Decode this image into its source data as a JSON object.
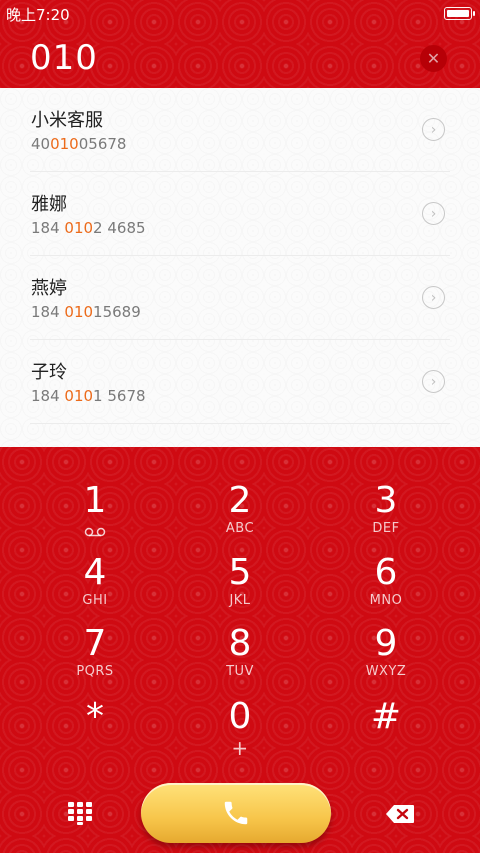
{
  "status_bar": {
    "time": "晚上7:20"
  },
  "query": "010",
  "contacts": [
    {
      "name": "小米客服",
      "num_pre": "40",
      "num_hl": "010",
      "num_post": "05678"
    },
    {
      "name": "雅娜",
      "num_pre": "184 ",
      "num_hl": "010",
      "num_post": "2 4685"
    },
    {
      "name": "燕婷",
      "num_pre": "184 ",
      "num_hl": "010",
      "num_post": "15689"
    },
    {
      "name": "子玲",
      "num_pre": "184 ",
      "num_hl": "010",
      "num_post": "1 5678"
    }
  ],
  "keys": [
    {
      "digit": "1",
      "letters": "",
      "icon": "voicemail-icon"
    },
    {
      "digit": "2",
      "letters": "ABC"
    },
    {
      "digit": "3",
      "letters": "DEF"
    },
    {
      "digit": "4",
      "letters": "GHI"
    },
    {
      "digit": "5",
      "letters": "JKL"
    },
    {
      "digit": "6",
      "letters": "MNO"
    },
    {
      "digit": "7",
      "letters": "PQRS"
    },
    {
      "digit": "8",
      "letters": "TUV"
    },
    {
      "digit": "9",
      "letters": "WXYZ"
    },
    {
      "digit": "*",
      "letters": ""
    },
    {
      "digit": "0",
      "letters": "+"
    },
    {
      "digit": "#",
      "letters": ""
    }
  ],
  "colors": {
    "accent": "#ec6b1b",
    "background": "#cf0a12",
    "call_button": "#f7c54a"
  },
  "icons": {
    "clear": "close-icon",
    "chevron": "chevron-right-icon",
    "dialpad": "dialpad-icon",
    "call": "phone-icon",
    "delete": "backspace-icon"
  }
}
